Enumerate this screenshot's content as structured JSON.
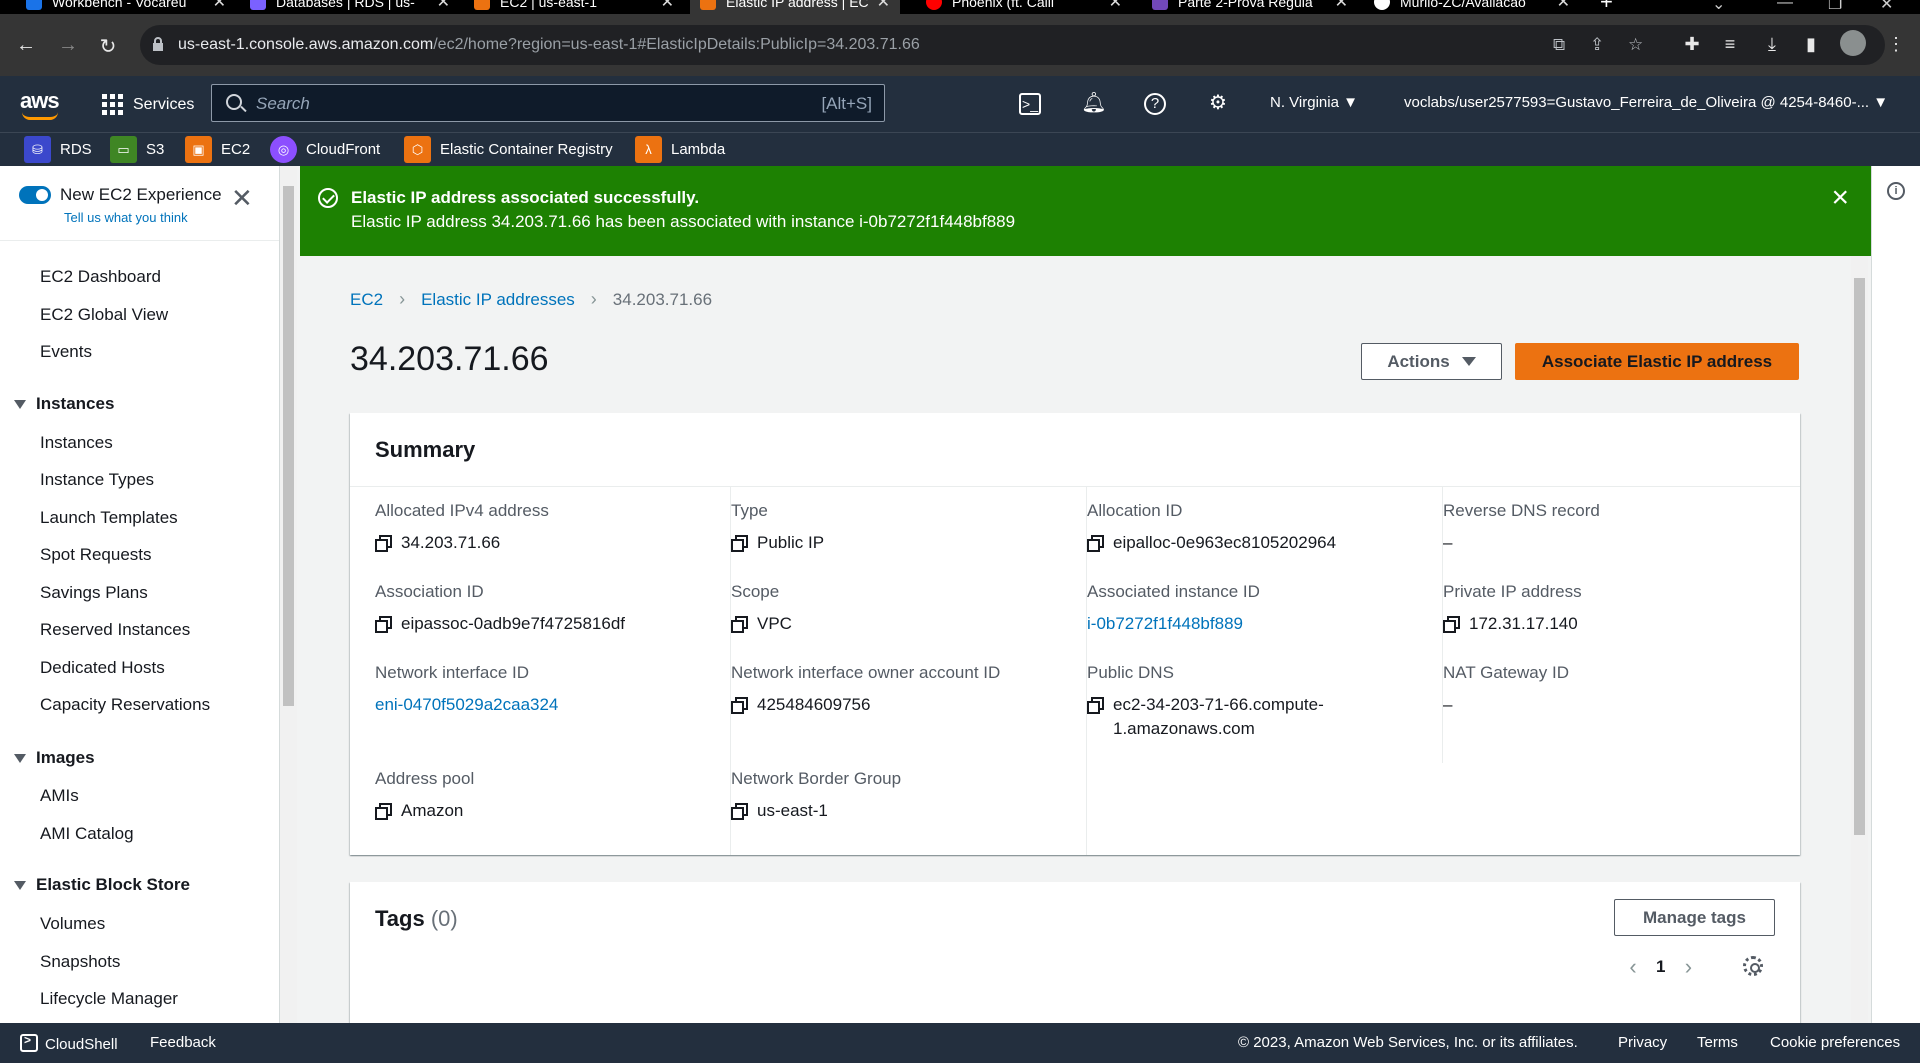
{
  "browser": {
    "tabs": [
      {
        "title": "Workbench - Vocareu",
        "color": "#1a73e8"
      },
      {
        "title": "Databases | RDS | us-",
        "color": "#7b61ff"
      },
      {
        "title": "EC2 | us-east-1",
        "color": "#ec7211"
      },
      {
        "title": "Elastic IP address | EC",
        "color": "#ec7211"
      },
      {
        "title": "Phoenix (ft. Caili",
        "color": "#ff0000"
      },
      {
        "title": "Parte 2-Prova Regula",
        "color": "#7248b9"
      },
      {
        "title": "Murilo-ZC/Avaliacao",
        "color": "#ffffff"
      }
    ],
    "url_host": "us-east-1.console.aws.amazon.com",
    "url_path": "/ec2/home?region=us-east-1#ElasticIpDetails:PublicIp=34.203.71.66"
  },
  "aws_header": {
    "logo": "aws",
    "services": "Services",
    "search_placeholder": "Search",
    "search_shortcut": "[Alt+S]",
    "region": "N. Virginia",
    "account": "voclabs/user2577593=Gustavo_Ferreira_de_Oliveira @ 4254-8460-..."
  },
  "favorites": [
    {
      "label": "RDS",
      "color": "#3b48cc"
    },
    {
      "label": "S3",
      "color": "#3f8624"
    },
    {
      "label": "EC2",
      "color": "#ec7211"
    },
    {
      "label": "CloudFront",
      "color": "#8c4fff"
    },
    {
      "label": "Elastic Container Registry",
      "color": "#ec7211"
    },
    {
      "label": "Lambda",
      "color": "#ec7211"
    }
  ],
  "sidebar": {
    "new_experience": "New EC2 Experience",
    "tell_us": "Tell us what you think",
    "top_links": [
      "EC2 Dashboard",
      "EC2 Global View",
      "Events"
    ],
    "instances_section": "Instances",
    "instances_links": [
      "Instances",
      "Instance Types",
      "Launch Templates",
      "Spot Requests",
      "Savings Plans",
      "Reserved Instances",
      "Dedicated Hosts",
      "Capacity Reservations"
    ],
    "images_section": "Images",
    "images_links": [
      "AMIs",
      "AMI Catalog"
    ],
    "ebs_section": "Elastic Block Store",
    "ebs_links": [
      "Volumes",
      "Snapshots",
      "Lifecycle Manager"
    ]
  },
  "flash": {
    "title": "Elastic IP address associated successfully.",
    "message": "Elastic IP address 34.203.71.66 has been associated with instance i-0b7272f1f448bf889"
  },
  "breadcrumb": [
    "EC2",
    "Elastic IP addresses",
    "34.203.71.66"
  ],
  "page_title": "34.203.71.66",
  "actions_label": "Actions",
  "primary_label": "Associate Elastic IP address",
  "summary": {
    "title": "Summary",
    "allocated_ipv4": {
      "label": "Allocated IPv4 address",
      "value": "34.203.71.66"
    },
    "association_id": {
      "label": "Association ID",
      "value": "eipassoc-0adb9e7f4725816df"
    },
    "network_interface_id": {
      "label": "Network interface ID",
      "value": "eni-0470f5029a2caa324"
    },
    "address_pool": {
      "label": "Address pool",
      "value": "Amazon"
    },
    "type": {
      "label": "Type",
      "value": "Public IP"
    },
    "scope": {
      "label": "Scope",
      "value": "VPC"
    },
    "owner_account": {
      "label": "Network interface owner account ID",
      "value": "425484609756"
    },
    "border_group": {
      "label": "Network Border Group",
      "value": "us-east-1"
    },
    "allocation_id": {
      "label": "Allocation ID",
      "value": "eipalloc-0e963ec8105202964"
    },
    "instance_id": {
      "label": "Associated instance ID",
      "value": "i-0b7272f1f448bf889"
    },
    "public_dns": {
      "label": "Public DNS",
      "value": "ec2-34-203-71-66.compute-1.amazonaws.com"
    },
    "reverse_dns": {
      "label": "Reverse DNS record",
      "value": "–"
    },
    "private_ip": {
      "label": "Private IP address",
      "value": "172.31.17.140"
    },
    "nat_gateway": {
      "label": "NAT Gateway ID",
      "value": "–"
    }
  },
  "tags": {
    "title": "Tags",
    "count": "(0)",
    "manage_label": "Manage tags",
    "page": "1"
  },
  "footer": {
    "cloudshell": "CloudShell",
    "feedback": "Feedback",
    "copyright": "© 2023, Amazon Web Services, Inc. or its affiliates.",
    "privacy": "Privacy",
    "terms": "Terms",
    "cookies": "Cookie preferences"
  }
}
